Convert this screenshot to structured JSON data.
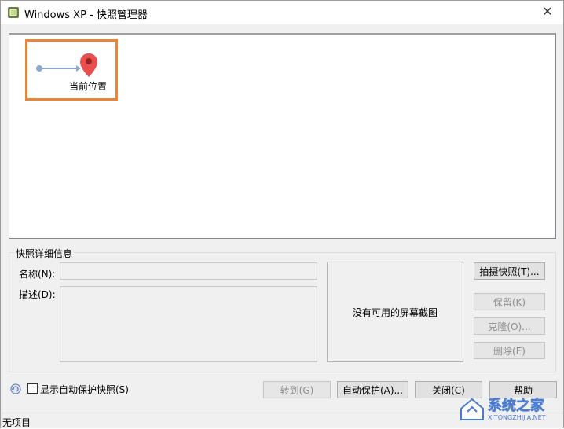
{
  "window": {
    "title": "Windows XP - 快照管理器",
    "close_glyph": "✕"
  },
  "tree": {
    "current_node_label": "当前位置"
  },
  "details": {
    "legend": "快照详细信息",
    "name_label": "名称(N):",
    "desc_label": "描述(D):",
    "name_value": "",
    "desc_value": "",
    "preview_text": "没有可用的屏幕截图"
  },
  "side_buttons": {
    "take_snapshot": "拍摄快照(T)...",
    "keep": "保留(K)",
    "clone": "克隆(O)...",
    "delete": "删除(E)"
  },
  "footer": {
    "show_autoprotect": "显示自动保护快照(S)",
    "goto": "转到(G)",
    "autoprotect": "自动保护(A)...",
    "close": "关闭(C)",
    "help": "帮助"
  },
  "status": {
    "text": "无项目"
  },
  "watermark": {
    "text": "系统之家",
    "url": "XITONGZHIJIA.NET"
  },
  "colors": {
    "highlight_border": "#e8863c",
    "pin": "#e94f4f",
    "arrow": "#8fa8cc"
  },
  "icons": {
    "app": "vmware-app-icon",
    "pin": "map-pin-icon",
    "autosave": "autoprotect-clock-icon"
  }
}
